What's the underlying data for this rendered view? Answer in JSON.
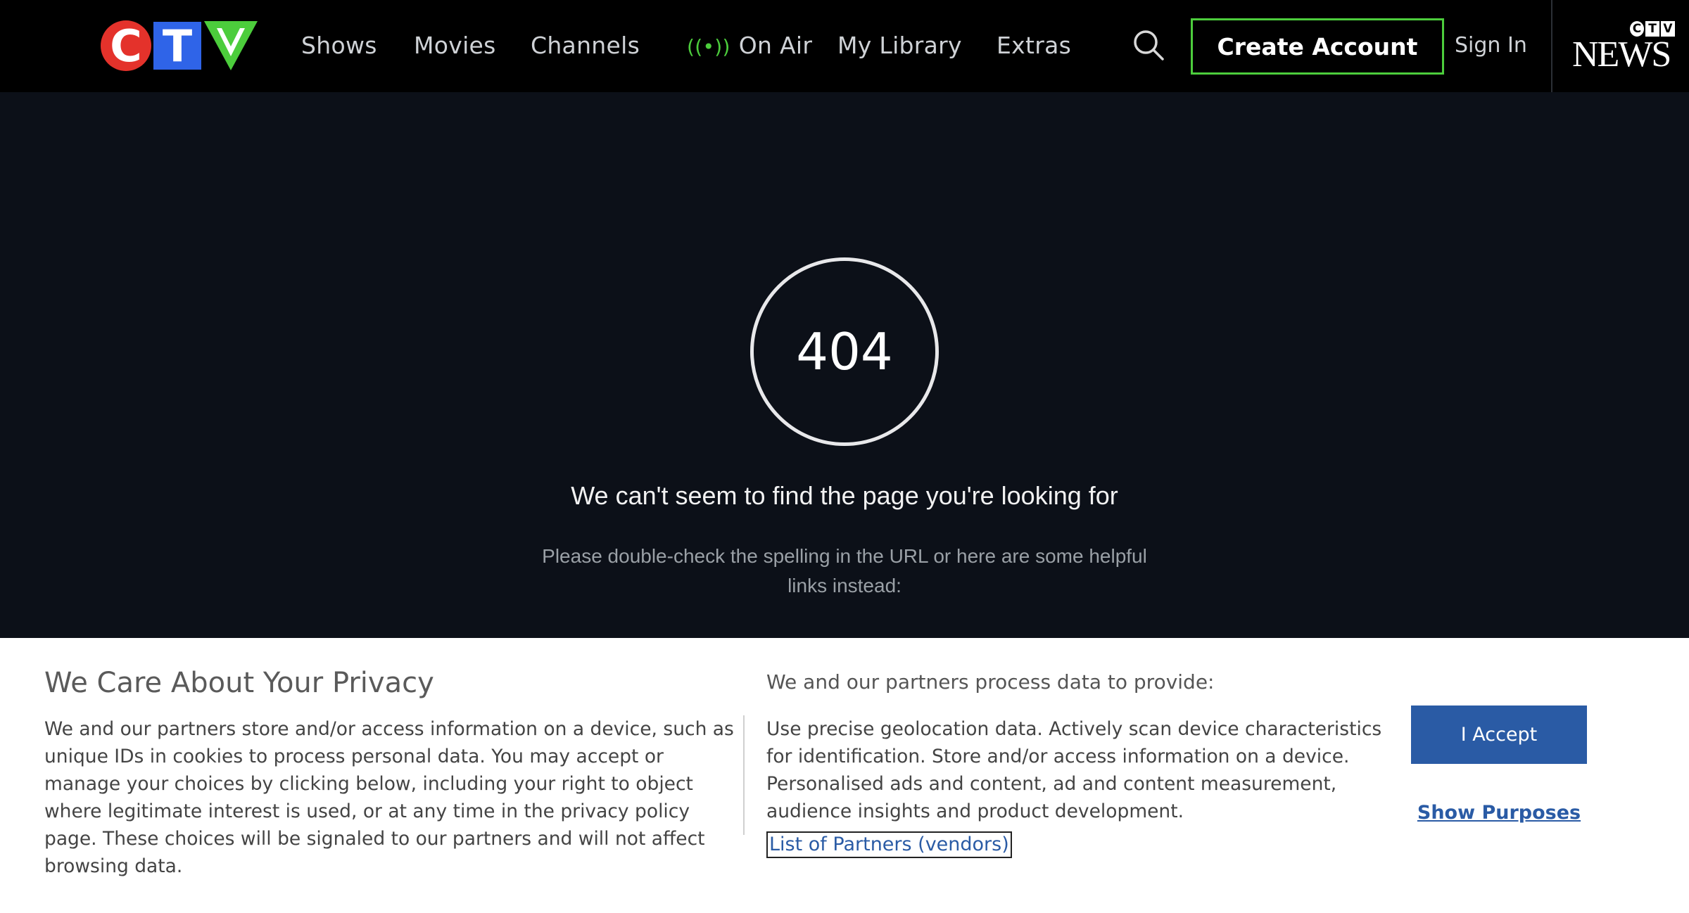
{
  "header": {
    "logo": {
      "letters": [
        "C",
        "T",
        "V"
      ],
      "colors": [
        "#e4322b",
        "#2f64e8",
        "#4ccd3c"
      ]
    },
    "nav": [
      {
        "label": "Shows"
      },
      {
        "label": "Movies"
      },
      {
        "label": "Channels"
      },
      {
        "label": "On Air",
        "icon": "broadcast-icon"
      },
      {
        "label": "My Library"
      },
      {
        "label": "Extras"
      }
    ],
    "search_icon": "search-icon",
    "create_account": "Create Account",
    "sign_in": "Sign In",
    "news_logo": {
      "small": [
        "C",
        "T",
        "V"
      ],
      "word": "NEWS"
    }
  },
  "error": {
    "code": "404",
    "title": "We can't seem to find the page you're looking for",
    "subtitle": "Please double-check the spelling in the URL or here are some helpful links instead:"
  },
  "privacy": {
    "title": "We Care About Your Privacy",
    "body": "We and our partners store and/or access information on a device, such as unique IDs in cookies to process personal data. You may accept or manage your choices by clicking below, including your right to object where legitimate interest is used, or at any time in the privacy policy page. These choices will be signaled to our partners and will not affect browsing data.",
    "right_title": "We and our partners process data to provide:",
    "right_body": "Use precise geolocation data. Actively scan device characteristics for identification. Store and/or access information on a device. Personalised ads and content, ad and content measurement, audience insights and product development.",
    "partners_link": "List of Partners (vendors)",
    "accept": "I Accept",
    "show_purposes": "Show Purposes"
  },
  "colors": {
    "accent_green": "#4ccd3c",
    "privacy_blue": "#2a5ba5",
    "page_bg": "#0c1018"
  }
}
